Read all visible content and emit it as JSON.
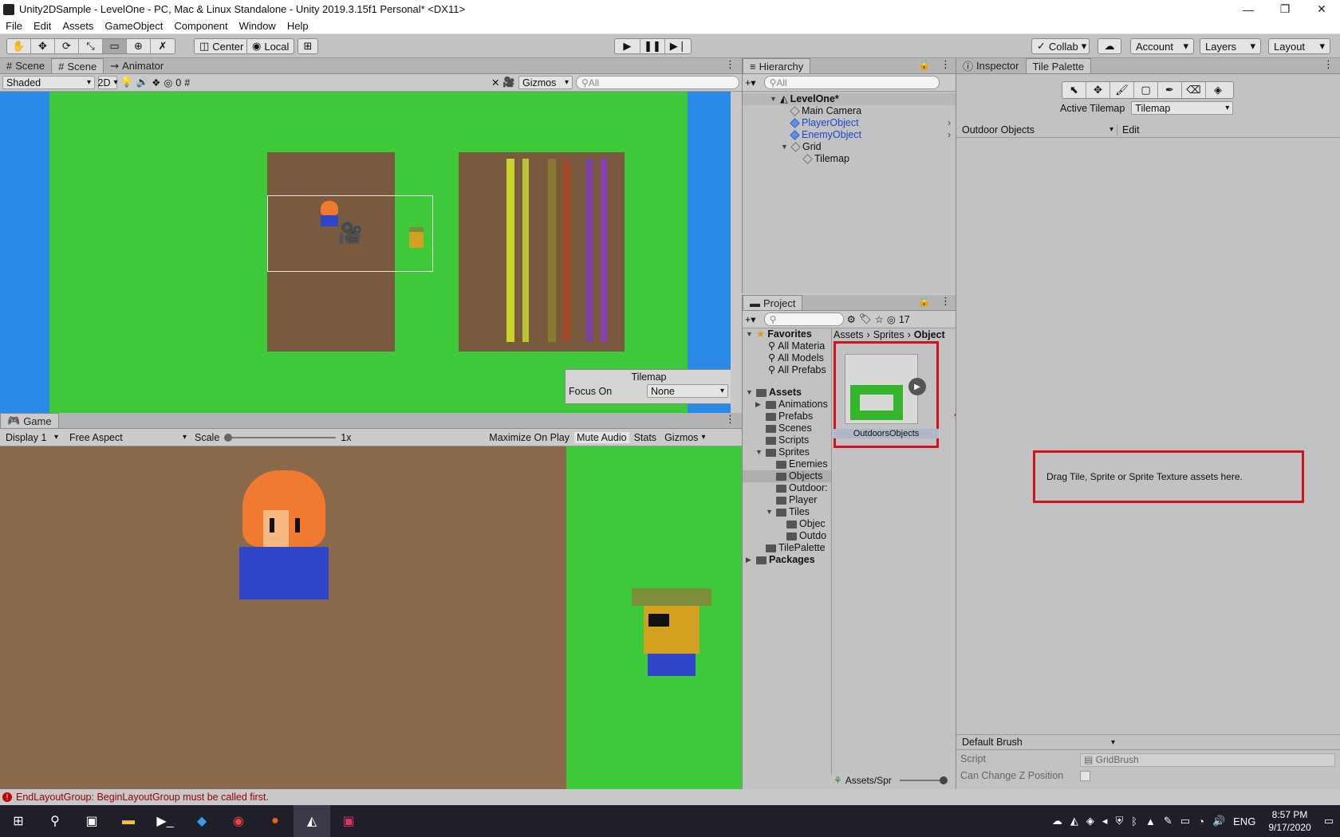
{
  "window": {
    "title": "Unity2DSample - LevelOne - PC, Mac & Linux Standalone - Unity 2019.3.15f1 Personal* <DX11>"
  },
  "menu": [
    "File",
    "Edit",
    "Assets",
    "GameObject",
    "Component",
    "Window",
    "Help"
  ],
  "toolbar": {
    "center": "Center",
    "local": "Local",
    "collab": "Collab",
    "account": "Account",
    "layers": "Layers",
    "layout": "Layout"
  },
  "scene_tabs": [
    "Scene",
    "Scene",
    "Animator"
  ],
  "scene_bar": {
    "shading": "Shaded",
    "mode2d": "2D",
    "hidden_count": "0",
    "gizmos": "Gizmos",
    "search_placeholder": "All"
  },
  "tilemap_overlay": {
    "title": "Tilemap",
    "focus_label": "Focus On",
    "focus_value": "None"
  },
  "game": {
    "tab": "Game",
    "display": "Display 1",
    "aspect": "Free Aspect",
    "scale_label": "Scale",
    "scale_value": "1x",
    "maximize": "Maximize On Play",
    "mute": "Mute Audio",
    "stats": "Stats",
    "gizmos": "Gizmos"
  },
  "hierarchy": {
    "tab": "Hierarchy",
    "search_placeholder": "All",
    "items": [
      {
        "label": "LevelOne*"
      },
      {
        "label": "Main Camera"
      },
      {
        "label": "PlayerObject"
      },
      {
        "label": "EnemyObject"
      },
      {
        "label": "Grid"
      },
      {
        "label": "Tilemap"
      }
    ]
  },
  "project": {
    "tab": "Project",
    "hidden_count": "17",
    "favorites": {
      "label": "Favorites",
      "items": [
        "All Materia",
        "All Models",
        "All Prefabs"
      ]
    },
    "assets": {
      "label": "Assets",
      "items": [
        "Animations",
        "Prefabs",
        "Scenes",
        "Scripts",
        "Sprites",
        "Enemies",
        "Objects",
        "Outdoor:",
        "Player",
        "Tiles",
        "Objec",
        "Outdo",
        "TilePalette"
      ]
    },
    "packages": "Packages",
    "breadcrumb": [
      "Assets",
      "Sprites",
      "Object"
    ],
    "asset_name": "OutdoorsObjects",
    "footer_path": "Assets/Spr"
  },
  "inspector": {
    "tab_inspector": "Inspector",
    "tab_palette": "Tile Palette",
    "active_tilemap_label": "Active Tilemap",
    "active_tilemap_value": "Tilemap",
    "palette": "Outdoor Objects",
    "edit": "Edit",
    "drop_hint": "Drag Tile, Sprite or Sprite Texture assets here.",
    "brush": "Default Brush",
    "script_label": "Script",
    "script_value": "GridBrush",
    "zpos_label": "Can Change Z Position"
  },
  "status": {
    "error": "EndLayoutGroup: BeginLayoutGroup must be called first."
  },
  "clock": {
    "time": "8:57 PM",
    "date": "9/17/2020",
    "lang": "ENG"
  },
  "colors": {
    "grass": "#3dc93a",
    "water": "#2a8ae8",
    "dirt": "#7a5a3e",
    "annotation": "#d4121f"
  }
}
